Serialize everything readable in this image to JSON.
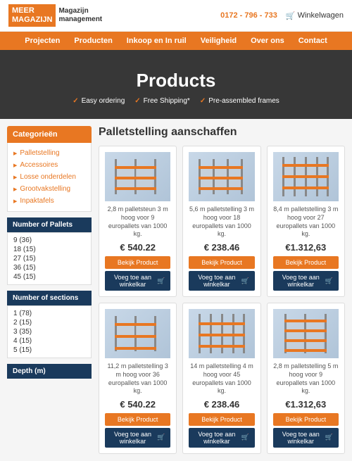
{
  "header": {
    "logo_line1": "MEER",
    "logo_line2": "MAGAZIJN",
    "phone": "0172 - 796 - 733",
    "cart_label": "Winkelwagen"
  },
  "nav": {
    "items": [
      {
        "label": "Projecten"
      },
      {
        "label": "Producten"
      },
      {
        "label": "Inkoop en In ruil"
      },
      {
        "label": "Veiligheid"
      },
      {
        "label": "Over ons"
      },
      {
        "label": "Contact"
      }
    ]
  },
  "hero": {
    "title": "Products",
    "badge1": "Easy ordering",
    "badge2": "Free Shipping*",
    "badge3": "Pre-assembled frames"
  },
  "sidebar": {
    "categories_title": "Categorieën",
    "category_links": [
      {
        "label": "Palletstelling"
      },
      {
        "label": "Accessoires"
      },
      {
        "label": "Losse onderdelen"
      },
      {
        "label": "Grootvakstelling"
      },
      {
        "label": "Inpaktafels"
      }
    ],
    "filter1_title": "Number of Pallets",
    "filter1_items": [
      "9 (36)",
      "18 (15)",
      "27 (15)",
      "36 (15)",
      "45 (15)"
    ],
    "filter2_title": "Number of sections",
    "filter2_items": [
      "1 (78)",
      "2 (15)",
      "3 (35)",
      "4 (15)",
      "5 (15)"
    ],
    "filter3_title": "Depth (m)"
  },
  "products": {
    "page_title": "Palletstelling aanschaffen",
    "items": [
      {
        "desc": "2,8 m palletsteun 3 m hoog voor 9 europallets van 1000 kg.",
        "price": "€ 540.22",
        "btn_view": "Bekijk Product",
        "btn_cart": "Voeg toe aan winkelkar"
      },
      {
        "desc": "5,6 m palletstelling 3 m hoog voor 18 europallets van 1000 kg.",
        "price": "€ 238.46",
        "btn_view": "Bekijk Product",
        "btn_cart": "Voeg toe aan winkelkar"
      },
      {
        "desc": "8,4 m palletstelling 3 m hoog voor 27 europallets van 1000 kg.",
        "price": "€1.312,63",
        "btn_view": "Bekijk Product",
        "btn_cart": "Voeg toe aan winkelkar"
      },
      {
        "desc": "11,2 m palletstelling 3 m hoog voor 36 europallets van 1000 kg.",
        "price": "€ 540.22",
        "btn_view": "Bekijk Product",
        "btn_cart": "Voeg toe aan winkelkar"
      },
      {
        "desc": "14 m palletstelling 4 m hoog voor 45 europallets van 1000 kg.",
        "price": "€ 238.46",
        "btn_view": "Bekijk Product",
        "btn_cart": "Voeg toe aan winkelkar"
      },
      {
        "desc": "2,8 m palletstelling 5 m hoog voor 9 europallets van 1000 kg.",
        "price": "€1.312,63",
        "btn_view": "Bekijk Product",
        "btn_cart": "Voeg toe aan winkelkar"
      }
    ]
  }
}
